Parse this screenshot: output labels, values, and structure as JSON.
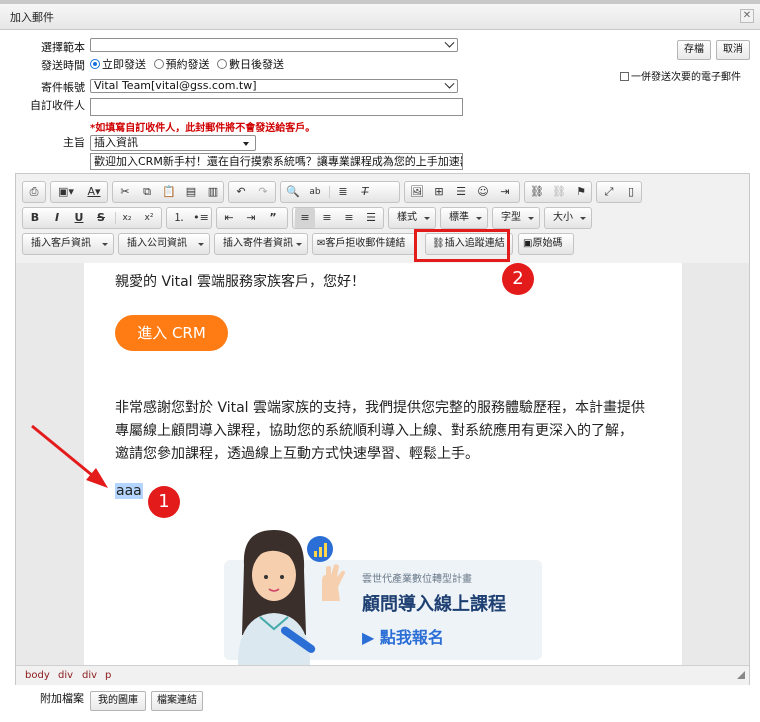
{
  "window": {
    "title": "加入郵件"
  },
  "form": {
    "template_label": "選擇範本",
    "template_value": "",
    "send_time_label": "發送時間",
    "send_options": [
      "立即發送",
      "預約發送",
      "數日後發送"
    ],
    "sender_label": "寄件帳號",
    "sender_value": "Vital Team[vital@gss.com.tw]",
    "custom_recipient_label": "自訂收件人",
    "custom_recipient_value": "",
    "warning": "*如填寫自訂收件人，此封郵件將不會發送給客戶。",
    "subject_label": "主旨",
    "insert_info_value": "插入資訊",
    "subject_value": "歡迎加入CRM新手村！還在自行摸索系統嗎？讓專業課程成為您的上手加速器，"
  },
  "actions": {
    "save": "存檔",
    "cancel": "取消",
    "send_secondary": "一併發送次要的電子郵件"
  },
  "toolbar": {
    "styles": "樣式",
    "format": "標準",
    "font": "字型",
    "size": "大小",
    "insert_customer": "插入客戶資訊",
    "insert_company": "插入公司資訊",
    "insert_sender": "插入寄件者資訊",
    "unsubscribe_link": "客戶拒收郵件鏈結",
    "insert_tracking": "插入追蹤連結",
    "source": "原始碼"
  },
  "body": {
    "greeting": "親愛的 Vital 雲端服務家族客戶，您好！",
    "cta": "進入 CRM",
    "paragraph": "非常感謝您對於 Vital 雲端家族的支持，我們提供您完整的服務體驗歷程，本計畫提供專屬線上顧問導入課程，協助您的系統順利導入上線、對系統應用有更深入的了解，邀請您參加課程，透過線上互動方式快速學習、輕鬆上手。",
    "selected_text": "aaa",
    "banner_small": "雲世代產業數位轉型計畫",
    "banner_title": "顧問導入線上課程",
    "banner_link": "點我報名"
  },
  "statusbar": {
    "path": [
      "body",
      "div",
      "div",
      "p"
    ]
  },
  "attachments": {
    "label": "附加檔案",
    "library": "我的圖庫",
    "file_link": "檔案連結"
  },
  "annotations": {
    "badge1": "1",
    "badge2": "2",
    "color": "#e41b1b"
  },
  "colors": {
    "cta": "#ff7b14",
    "banner_bg": "#eef3f7",
    "banner_title": "#1d3f72",
    "banner_link": "#2b6fd6",
    "selection": "#b4d5ff"
  }
}
